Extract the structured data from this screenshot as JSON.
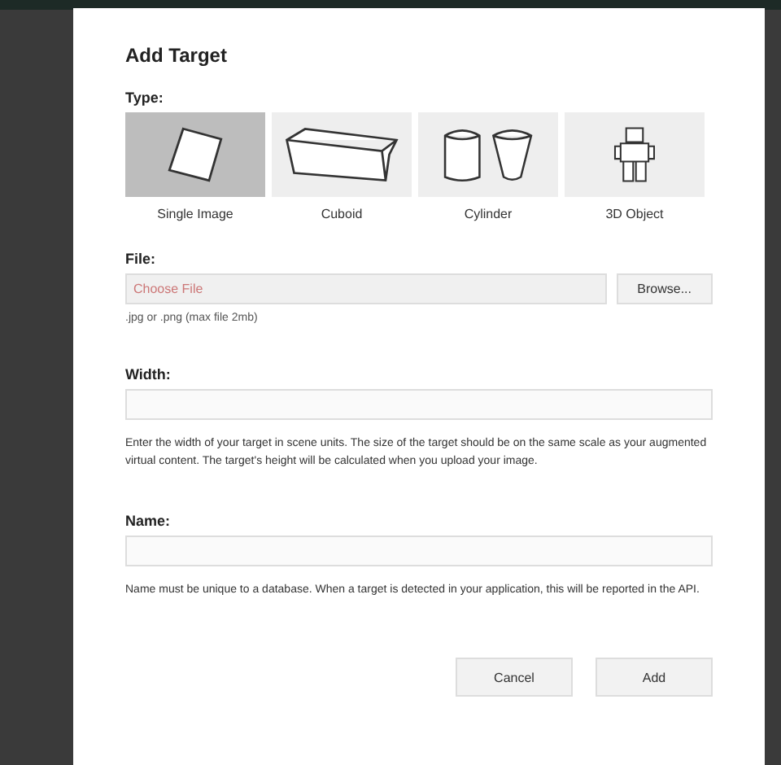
{
  "dialog": {
    "title": "Add Target",
    "type": {
      "label": "Type:",
      "options": [
        {
          "label": "Single Image",
          "kind": "image",
          "selected": true
        },
        {
          "label": "Cuboid",
          "kind": "cuboid",
          "selected": false
        },
        {
          "label": "Cylinder",
          "kind": "cylinder",
          "selected": false
        },
        {
          "label": "3D Object",
          "kind": "object",
          "selected": false
        }
      ]
    },
    "file": {
      "label": "File:",
      "placeholder": "Choose File",
      "button": "Browse...",
      "hint": ".jpg or .png (max file 2mb)"
    },
    "width": {
      "label": "Width:",
      "help": "Enter the width of your target in scene units. The size of the target should be on the same scale as your augmented virtual content. The target's height will be calculated when you upload your image."
    },
    "name": {
      "label": "Name:",
      "help": "Name must be unique to a database. When a target is detected in your application, this will be reported in the API."
    },
    "buttons": [
      "Cancel",
      "Add"
    ]
  }
}
